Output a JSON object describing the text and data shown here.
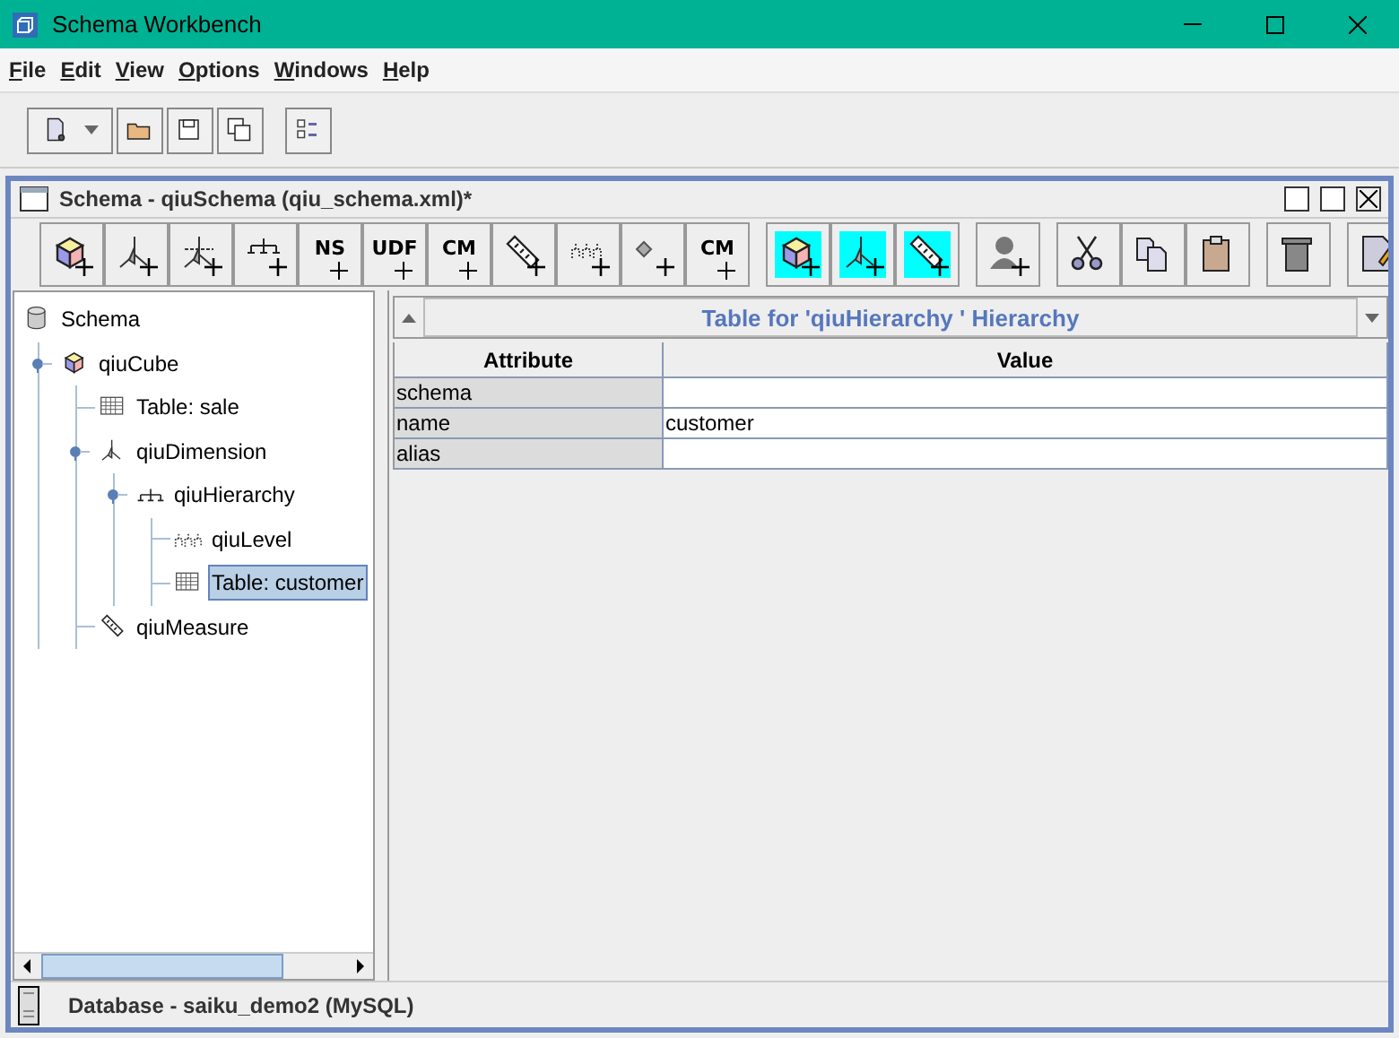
{
  "window": {
    "title": "Schema Workbench"
  },
  "menu": [
    {
      "label": "File"
    },
    {
      "label": "Edit"
    },
    {
      "label": "View"
    },
    {
      "label": "Options"
    },
    {
      "label": "Windows"
    },
    {
      "label": "Help"
    }
  ],
  "main_toolbar": [
    {
      "kind": "new"
    },
    {
      "kind": "open"
    },
    {
      "kind": "save"
    },
    {
      "kind": "saveas"
    },
    {
      "kind": "prefs"
    }
  ],
  "document": {
    "title": "Schema - qiuSchema (qiu_schema.xml)*",
    "toolbar": [
      {
        "kind": "cube"
      },
      {
        "kind": "dimension"
      },
      {
        "kind": "usage"
      },
      {
        "kind": "hierarchy"
      },
      {
        "kind": "text",
        "label": "NS"
      },
      {
        "kind": "text",
        "label": "UDF"
      },
      {
        "kind": "text",
        "label": "CM"
      },
      {
        "kind": "measure"
      },
      {
        "kind": "level"
      },
      {
        "kind": "property"
      },
      {
        "kind": "text",
        "label": "CM"
      },
      {
        "kind": "cube",
        "highlight": true
      },
      {
        "kind": "dimension",
        "highlight": true
      },
      {
        "kind": "measure",
        "highlight": true
      },
      {
        "kind": "role"
      },
      {
        "kind": "cut"
      },
      {
        "kind": "copy"
      },
      {
        "kind": "paste"
      },
      {
        "kind": "delete"
      },
      {
        "kind": "edit"
      }
    ],
    "tree": [
      {
        "label": "Schema",
        "kind": "schema",
        "selected": false,
        "children": [
          {
            "label": "qiuCube",
            "kind": "cube",
            "selected": false,
            "expanded": true,
            "children": [
              {
                "label": "Table: sale",
                "kind": "table",
                "selected": false
              },
              {
                "label": "qiuDimension",
                "kind": "dimension",
                "selected": false,
                "expanded": true,
                "children": [
                  {
                    "label": "qiuHierarchy",
                    "kind": "hierarchy",
                    "selected": false,
                    "expanded": true,
                    "children": [
                      {
                        "label": "qiuLevel",
                        "kind": "level",
                        "selected": false
                      },
                      {
                        "label": "Table: customer",
                        "kind": "table",
                        "selected": true
                      }
                    ]
                  }
                ]
              },
              {
                "label": "qiuMeasure",
                "kind": "measure",
                "selected": false
              }
            ]
          }
        ]
      }
    ],
    "properties": {
      "title": "Table for 'qiuHierarchy ' Hierarchy",
      "columns": [
        "Attribute",
        "Value"
      ],
      "rows": [
        {
          "attribute": "schema"
        },
        {
          "attribute": "name",
          "value": "customer"
        },
        {
          "attribute": "alias"
        }
      ]
    }
  },
  "status_bar": {
    "text": "Database - saiku_demo2 (MySQL)"
  }
}
